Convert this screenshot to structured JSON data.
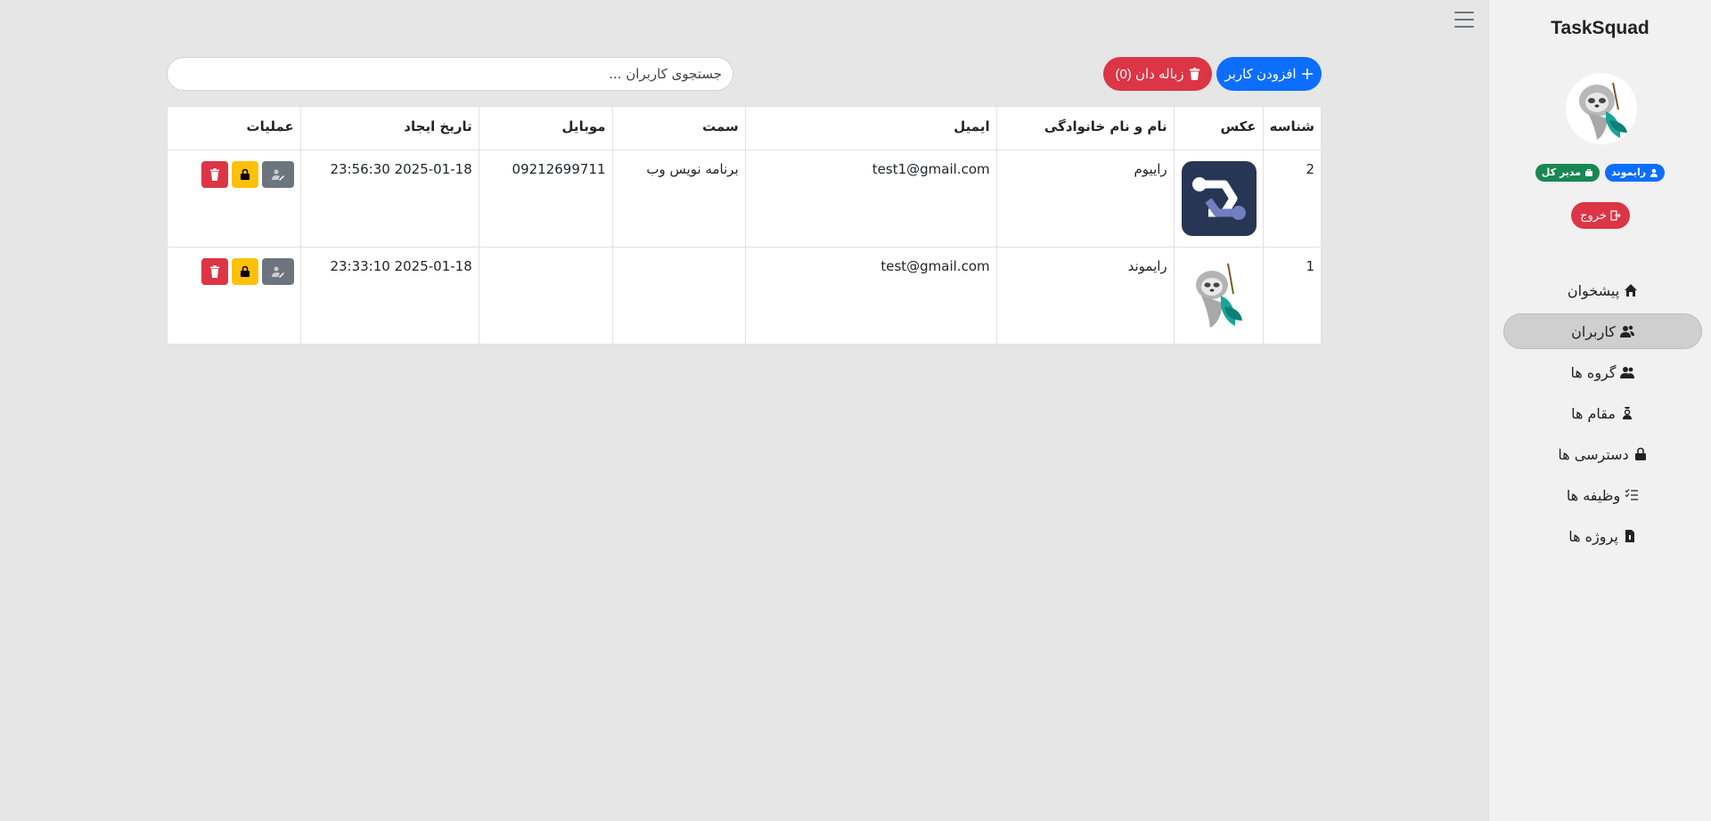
{
  "app": {
    "brand": "TaskSquad"
  },
  "profile": {
    "username_badge": "رایموند",
    "role_badge": "مدیر کل",
    "logout_label": "خروج"
  },
  "nav": {
    "dashboard": "پیشخوان",
    "users": "کاربران",
    "groups": "گروه ها",
    "roles": "مقام ها",
    "permissions": "دسترسی ها",
    "tasks": "وظیفه ها",
    "projects": "پروژه ها"
  },
  "toolbar": {
    "add_user": "افزودن کاربر",
    "trash": "زباله دان (0)",
    "search_placeholder": "جستجوی کاربران ..."
  },
  "table": {
    "headers": {
      "id": "شناسه",
      "photo": "عکس",
      "name": "نام و نام خانوادگی",
      "email": "ایمیل",
      "position": "سمت",
      "mobile": "موبایل",
      "created": "تاریخ ایجاد",
      "actions": "عملیات"
    },
    "rows": [
      {
        "id": "2",
        "photo": "logo-avatar",
        "name": "راییوم",
        "email": "test1@gmail.com",
        "position": "برنامه نویس وب",
        "mobile": "09212699711",
        "created": "2025-01-18 23:56:30"
      },
      {
        "id": "1",
        "photo": "sloth-avatar",
        "name": "رایموند",
        "email": "test@gmail.com",
        "position": "",
        "mobile": "",
        "created": "2025-01-18 23:33:10"
      }
    ]
  },
  "colors": {
    "primary": "#0d6efd",
    "danger": "#dc3545",
    "warning": "#ffc107",
    "secondary": "#6c757d",
    "success": "#198754"
  }
}
